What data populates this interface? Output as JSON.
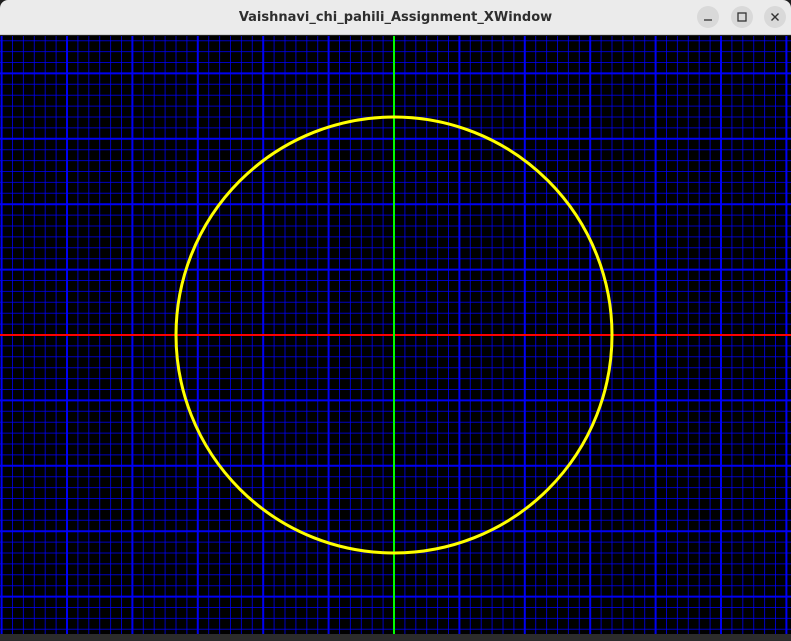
{
  "window": {
    "title": "Vaishnavi_chi_pahili_Assignment_XWindow"
  },
  "controls": {
    "minimize_icon": "minimize-icon",
    "maximize_icon": "maximize-icon",
    "close_icon": "close-icon"
  },
  "drawing": {
    "background_color": "#000000",
    "grid_color": "#0000ff",
    "x_axis_color": "#ff0000",
    "y_axis_color": "#00ff00",
    "circle_color": "#ffff00",
    "circle_radius_minor_grid_units": 20
  }
}
